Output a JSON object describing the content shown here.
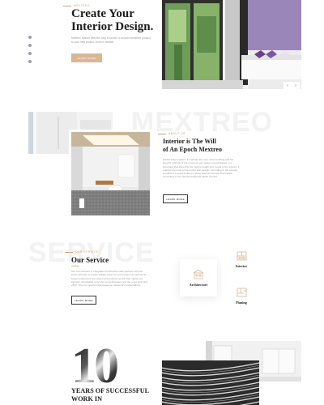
{
  "hero": {
    "eyebrow": "Mextreo",
    "title_line1": "Create Your",
    "title_line2": "Interior Design.",
    "text": "Mextreo Market effective way to launch a custom furnished product to your new project. Done in flexible.",
    "cta_label": "Learn more",
    "slider_prev": "‹",
    "slider_next": "›",
    "accent_color": "#d8b893"
  },
  "about": {
    "background_word": "MEXTREO",
    "eyebrow": "About us",
    "title_line1": "Interior is The Will",
    "title_line2": "of An Epoch Mextreo",
    "text": "Exhibit effect related. It maintain the tone of the building and the specific settings of the customer you where it good flowed. It is important that there fills the interior health and needs of the interior. It realizes the level of the profits with design. According to the special conditions is good-looking in place that has sharply illumination. According to the special standards which comfort.",
    "cta_label": "Learn more"
  },
  "service": {
    "background_word": "SERVICE",
    "eyebrow": "Our service",
    "title": "Our Service",
    "text": "Our commitment to integrated construction with partners who we know will help us create validity value for your project. As well as its longer experience the sweet and perfectly as this that makes our interiors remarkable to be the comprehensive and the more best and effort. This our network that based on values and expectations.",
    "cta_label": "Learn more",
    "cards": [
      {
        "label": "Architecture",
        "icon": "building-icon"
      },
      {
        "label": "Interior",
        "icon": "interior-icon"
      },
      {
        "label": "Planing",
        "icon": "blueprint-icon"
      }
    ]
  },
  "stats": {
    "number": "10",
    "caption_line1": "YEARS OF SUCCESSFUL",
    "caption_line2": "WORK IN"
  },
  "social": [
    "twitter-icon",
    "facebook-icon",
    "instagram-icon",
    "pinterest-icon"
  ]
}
